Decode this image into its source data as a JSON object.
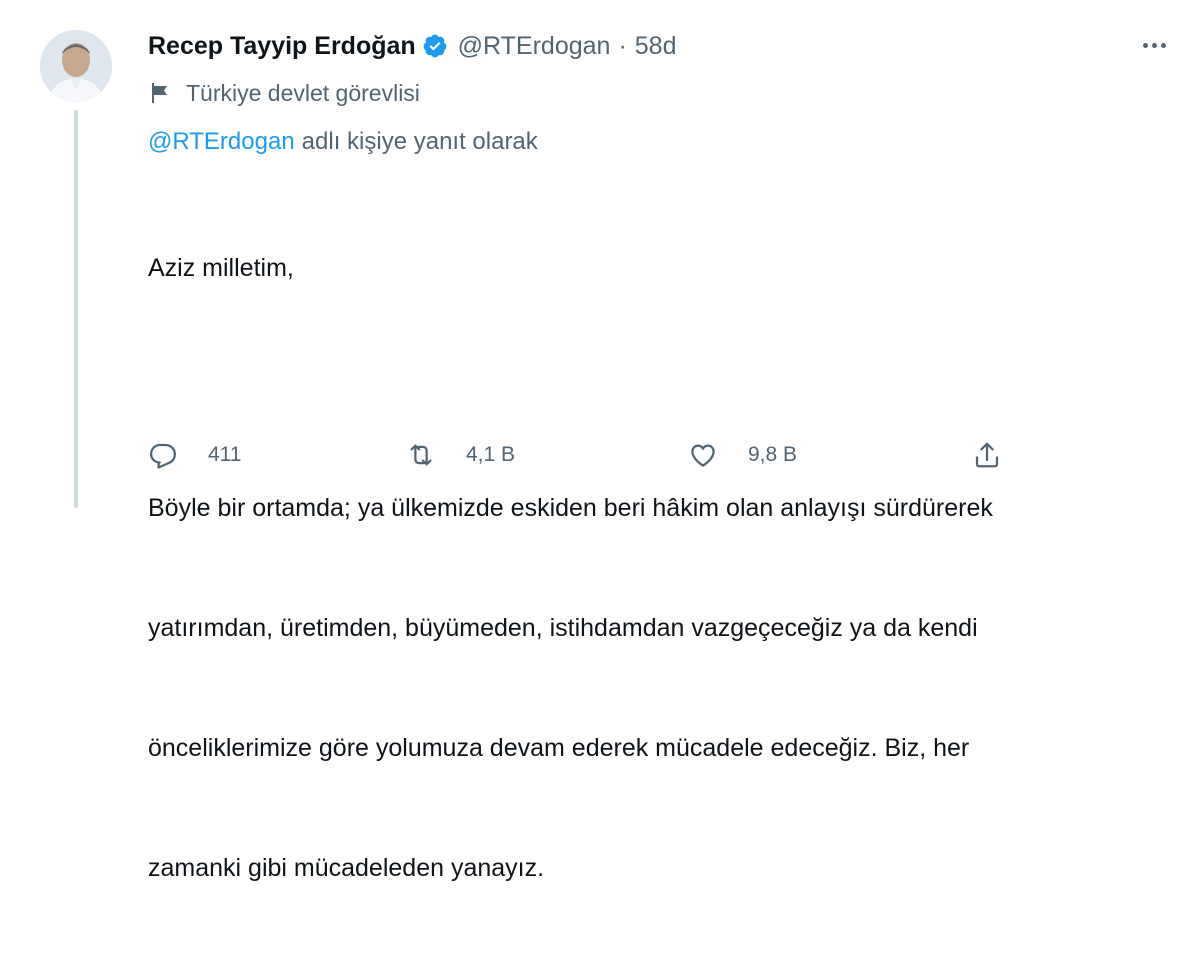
{
  "author": {
    "name": "Recep Tayyip Erdoğan",
    "handle": "@RTErdogan",
    "separator": "·",
    "time": "58d",
    "label": "Türkiye devlet görevlisi",
    "verified_color": "#1d9bf0"
  },
  "reply": {
    "handle": "@RTErdogan",
    "text": "adlı kişiye yanıt olarak"
  },
  "body": {
    "lines": [
      "Aziz milletim,",
      "",
      "Böyle bir ortamda; ya ülkemizde eskiden beri hâkim olan anlayışı sürdürerek",
      "yatırımdan, üretimden, büyümeden, istihdamdan vazgeçeceğiz ya da kendi",
      "önceliklerimize göre yolumuza devam ederek mücadele edeceğiz. Biz, her",
      "zamanki gibi mücadeleden yanayız."
    ]
  },
  "actions": {
    "reply_count": "411",
    "retweet_count": "4,1 B",
    "like_count": "9,8 B"
  },
  "icons": {
    "reply": "reply-icon",
    "retweet": "retweet-icon",
    "like": "heart-icon",
    "share": "share-icon",
    "more": "more-icon",
    "flag": "flag-icon",
    "verified": "verified-badge-icon"
  },
  "colors": {
    "text": "#0f1419",
    "secondary": "#536471",
    "link": "#1d9bf0",
    "thread_line": "#cfd9de"
  }
}
